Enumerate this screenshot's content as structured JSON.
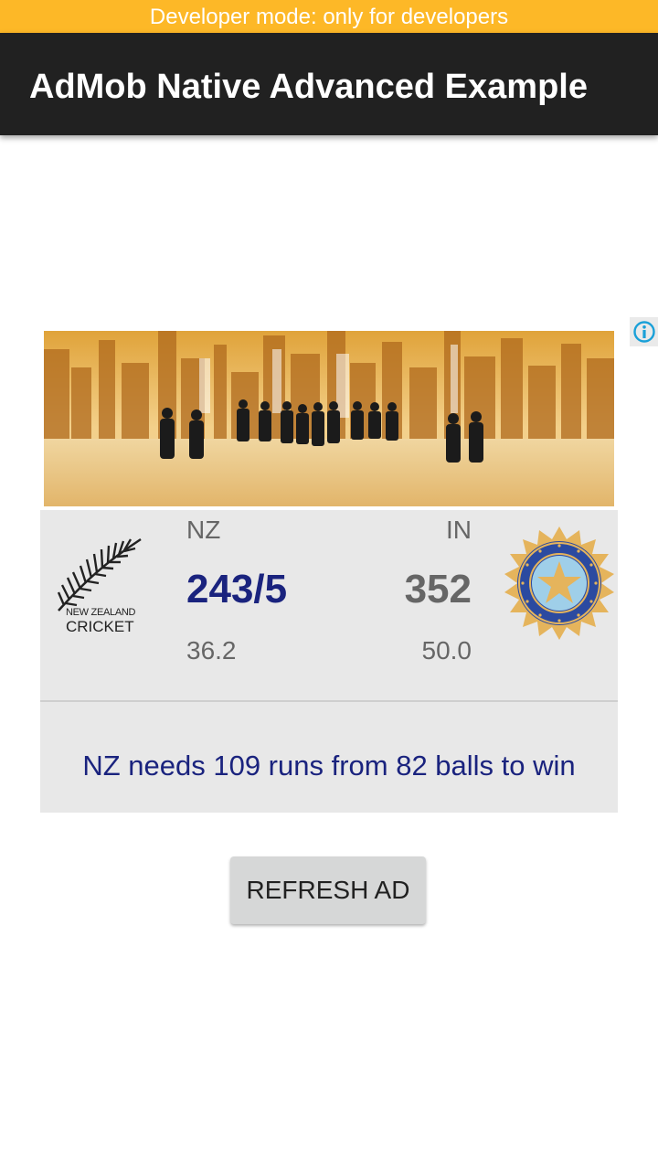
{
  "status_bar": {
    "dev_mode_text": "Developer mode: only for developers"
  },
  "app_bar": {
    "title": "AdMob Native Advanced Example"
  },
  "ad": {
    "adchoices_icon": "info-icon",
    "banner_icon": "business-people-skyline-image",
    "match": {
      "home": {
        "code": "NZ",
        "score": "243/5",
        "overs": "36.2",
        "logo_text_top": "NEW ZEALAND",
        "logo_text_bottom": "CRICKET",
        "score_color": "#1A237E"
      },
      "away": {
        "code": "IN",
        "score": "352",
        "overs": "50.0",
        "score_color": "#666666"
      },
      "status": "NZ needs 109 runs from 82 balls to win"
    }
  },
  "buttons": {
    "refresh_label": "REFRESH AD"
  },
  "colors": {
    "dev_bar": "#FDB827",
    "app_bar": "#212121",
    "status_text": "#1A237E"
  }
}
